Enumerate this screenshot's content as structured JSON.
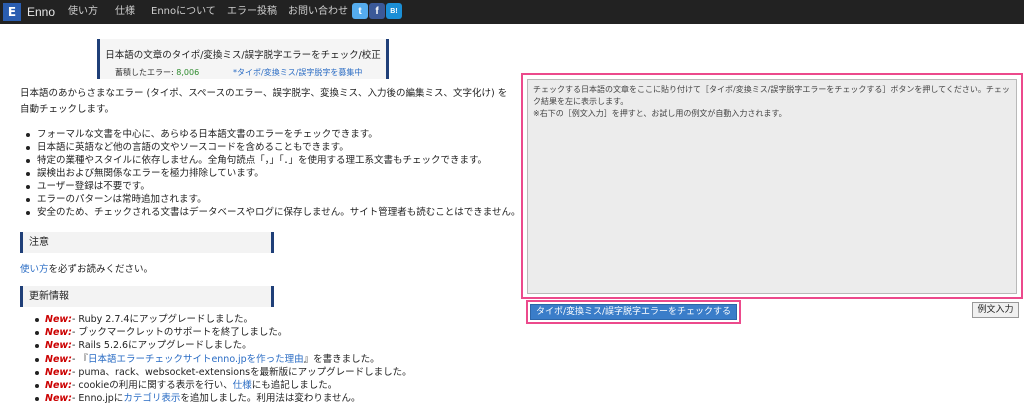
{
  "navbar": {
    "brand_letter": "E",
    "brand_name": "Enno",
    "links": [
      "使い方",
      "仕様",
      "Ennoについて",
      "エラー投稿",
      "お問い合わせ"
    ],
    "social": {
      "twitter": {
        "glyph": "t",
        "color": "#55acee"
      },
      "facebook": {
        "glyph": "f",
        "color": "#3b5998"
      },
      "hatena": {
        "glyph": "B!",
        "color": "#1b8fd6"
      }
    }
  },
  "header": {
    "title": "日本語の文章のタイポ/変換ミス/誤字脱字エラーをチェック/校正",
    "stats_label": "蓄積したエラー: ",
    "stats_count": "8,006",
    "recruit_link": "*タイポ/変換ミス/誤字脱字を募集中"
  },
  "intro": "日本語のあからさまなエラー (タイポ、スペースのエラー、誤字脱字、変換ミス、入力後の編集ミス、文字化け) を自動チェックします。",
  "features": [
    "フォーマルな文書を中心に、あらゆる日本語文書のエラーをチェックできます。",
    "日本語に英語など他の言語の文やソースコードを含めることもできます。",
    "特定の業種やスタイルに依存しません。全角句読点「，」「．」を使用する理工系文書もチェックできます。",
    "誤検出および無関係なエラーを極力排除しています。",
    "ユーザー登録は不要です。",
    "エラーのパターンは常時追加されます。",
    "安全のため、チェックされる文書はデータベースやログに保存しません。サイト管理者も読むことはできません。"
  ],
  "caution": {
    "heading": "注意",
    "link": "使い方",
    "text": "を必ずお読みください。"
  },
  "news": {
    "heading": "更新情報",
    "new_label": "New:",
    "items": [
      {
        "pre": "- Ruby 2.7.4にアップグレードしました。",
        "link": "",
        "post": ""
      },
      {
        "pre": "- ブックマークレットのサポートを終了しました。",
        "link": "",
        "post": ""
      },
      {
        "pre": "- Rails 5.2.6にアップグレードしました。",
        "link": "",
        "post": ""
      },
      {
        "pre": "- 『",
        "link": "日本語エラーチェックサイトenno.jpを作った理由",
        "post": "』を書きました。"
      },
      {
        "pre": "- puma、rack、websocket-extensionsを最新版にアップグレードしました。",
        "link": "",
        "post": ""
      },
      {
        "pre": "- cookieの利用に関する表示を行い、",
        "link": "仕様",
        "post": "にも追記しました。"
      },
      {
        "pre": "- Enno.jpに",
        "link": "カテゴリ表示",
        "post": "を追加しました。利用法は変わりません。"
      }
    ]
  },
  "editor": {
    "placeholder": "チェックする日本語の文章をここに貼り付けて［タイポ/変換ミス/誤字脱字エラーをチェックする］ボタンを押してください。チェック結果を左に表示します。\n※右下の［例文入力］を押すと、お試し用の例文が自動入力されます。",
    "check_button": "タイポ/変換ミス/誤字脱字エラーをチェックする",
    "example_button": "例文入力"
  }
}
